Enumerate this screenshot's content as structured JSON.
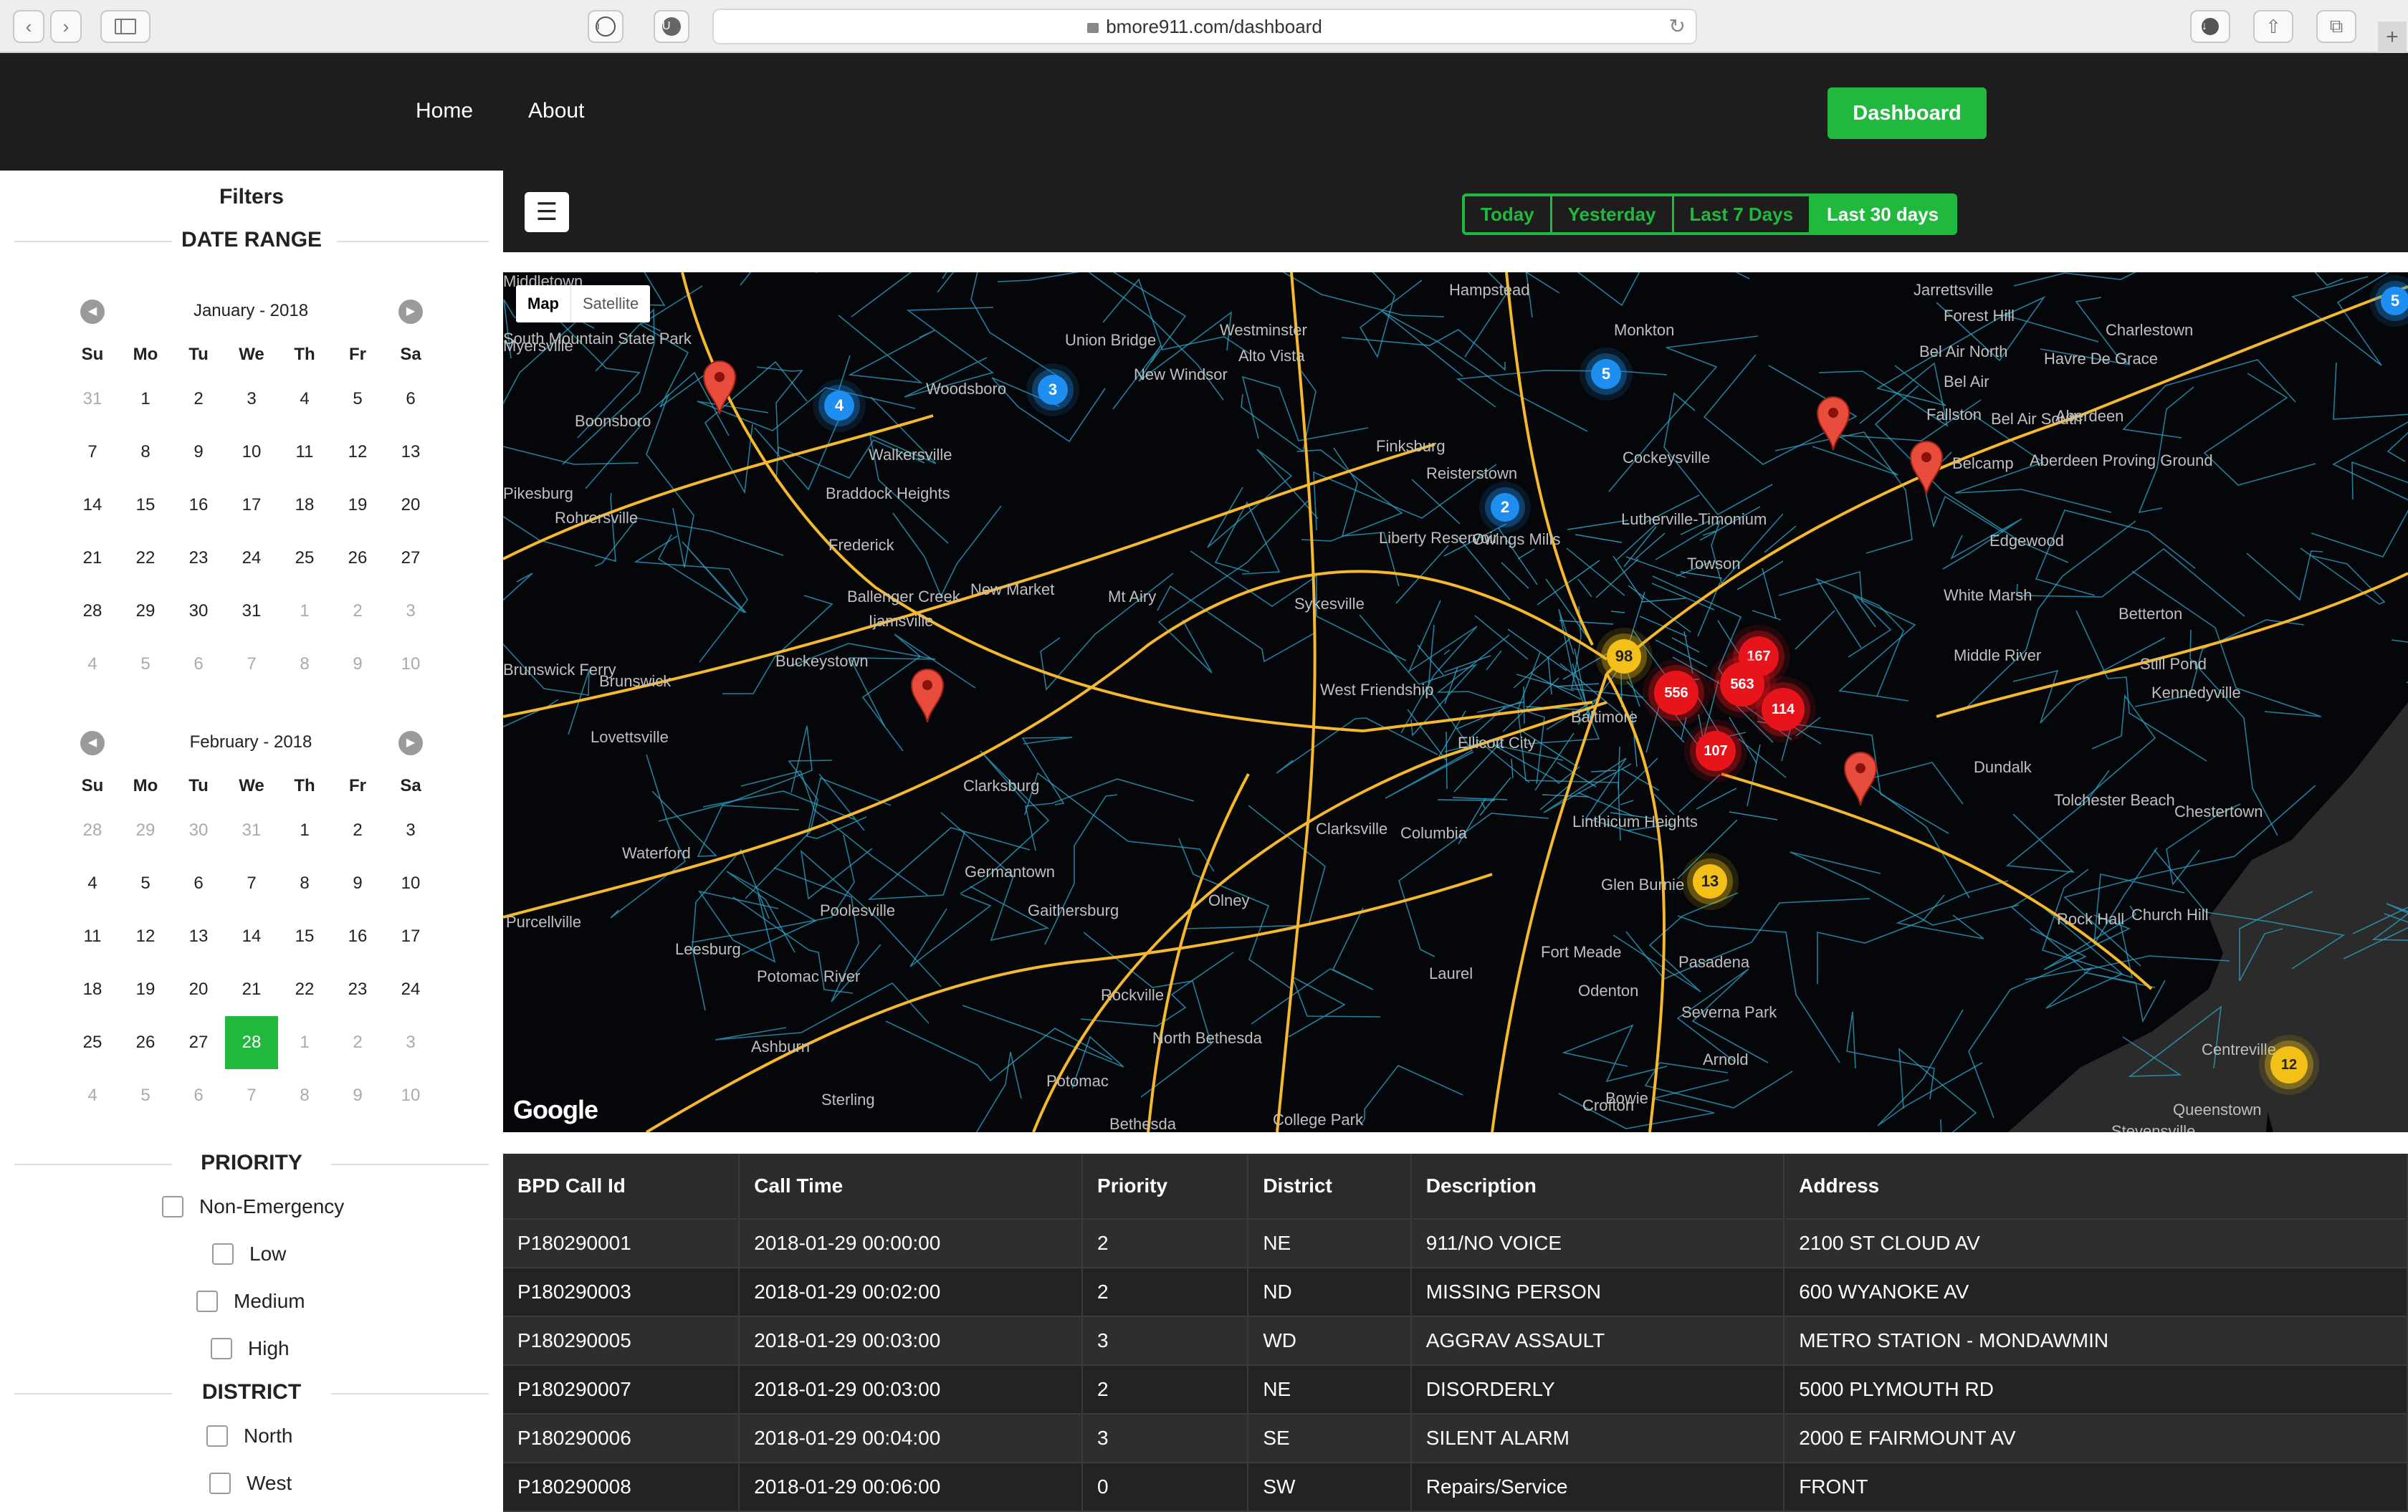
{
  "browser": {
    "url": "bmore911.com/dashboard"
  },
  "nav": {
    "home": "Home",
    "about": "About",
    "dashboard": "Dashboard"
  },
  "filters": {
    "title": "Filters",
    "date_range_title": "DATE RANGE",
    "calendars": [
      {
        "header": "January - 2018",
        "dow": [
          "Su",
          "Mo",
          "Tu",
          "We",
          "Th",
          "Fr",
          "Sa"
        ],
        "weeks": [
          [
            {
              "d": "31",
              "m": 1
            },
            {
              "d": "1"
            },
            {
              "d": "2"
            },
            {
              "d": "3"
            },
            {
              "d": "4"
            },
            {
              "d": "5"
            },
            {
              "d": "6"
            }
          ],
          [
            {
              "d": "7"
            },
            {
              "d": "8"
            },
            {
              "d": "9"
            },
            {
              "d": "10"
            },
            {
              "d": "11"
            },
            {
              "d": "12"
            },
            {
              "d": "13"
            }
          ],
          [
            {
              "d": "14"
            },
            {
              "d": "15"
            },
            {
              "d": "16"
            },
            {
              "d": "17"
            },
            {
              "d": "18"
            },
            {
              "d": "19"
            },
            {
              "d": "20"
            }
          ],
          [
            {
              "d": "21"
            },
            {
              "d": "22"
            },
            {
              "d": "23"
            },
            {
              "d": "24"
            },
            {
              "d": "25"
            },
            {
              "d": "26"
            },
            {
              "d": "27"
            }
          ],
          [
            {
              "d": "28"
            },
            {
              "d": "29"
            },
            {
              "d": "30"
            },
            {
              "d": "31"
            },
            {
              "d": "1",
              "m": 1
            },
            {
              "d": "2",
              "m": 1
            },
            {
              "d": "3",
              "m": 1
            }
          ],
          [
            {
              "d": "4",
              "m": 1
            },
            {
              "d": "5",
              "m": 1
            },
            {
              "d": "6",
              "m": 1
            },
            {
              "d": "7",
              "m": 1
            },
            {
              "d": "8",
              "m": 1
            },
            {
              "d": "9",
              "m": 1
            },
            {
              "d": "10",
              "m": 1
            }
          ]
        ]
      },
      {
        "header": "February - 2018",
        "dow": [
          "Su",
          "Mo",
          "Tu",
          "We",
          "Th",
          "Fr",
          "Sa"
        ],
        "weeks": [
          [
            {
              "d": "28",
              "m": 1
            },
            {
              "d": "29",
              "m": 1
            },
            {
              "d": "30",
              "m": 1
            },
            {
              "d": "31",
              "m": 1
            },
            {
              "d": "1"
            },
            {
              "d": "2"
            },
            {
              "d": "3"
            }
          ],
          [
            {
              "d": "4"
            },
            {
              "d": "5"
            },
            {
              "d": "6"
            },
            {
              "d": "7"
            },
            {
              "d": "8"
            },
            {
              "d": "9"
            },
            {
              "d": "10"
            }
          ],
          [
            {
              "d": "11"
            },
            {
              "d": "12"
            },
            {
              "d": "13"
            },
            {
              "d": "14"
            },
            {
              "d": "15"
            },
            {
              "d": "16"
            },
            {
              "d": "17"
            }
          ],
          [
            {
              "d": "18"
            },
            {
              "d": "19"
            },
            {
              "d": "20"
            },
            {
              "d": "21"
            },
            {
              "d": "22"
            },
            {
              "d": "23"
            },
            {
              "d": "24"
            }
          ],
          [
            {
              "d": "25"
            },
            {
              "d": "26"
            },
            {
              "d": "27"
            },
            {
              "d": "28",
              "s": 1
            },
            {
              "d": "1",
              "m": 1
            },
            {
              "d": "2",
              "m": 1
            },
            {
              "d": "3",
              "m": 1
            }
          ],
          [
            {
              "d": "4",
              "m": 1
            },
            {
              "d": "5",
              "m": 1
            },
            {
              "d": "6",
              "m": 1
            },
            {
              "d": "7",
              "m": 1
            },
            {
              "d": "8",
              "m": 1
            },
            {
              "d": "9",
              "m": 1
            },
            {
              "d": "10",
              "m": 1
            }
          ]
        ]
      }
    ],
    "priority_title": "PRIORITY",
    "priority_options": [
      "Non-Emergency",
      "Low",
      "Medium",
      "High"
    ],
    "district_title": "DISTRICT",
    "district_options": [
      "North",
      "West"
    ]
  },
  "toolbar": {
    "ranges": [
      "Today",
      "Yesterday",
      "Last 7 Days",
      "Last 30 days"
    ],
    "active_range": "Last 30 days"
  },
  "map": {
    "toggle": [
      "Map",
      "Satellite"
    ],
    "active_toggle": "Map",
    "attribution": "Google",
    "places": [
      "Hampstead",
      "Jarrettsville",
      "Forest Hill",
      "Bel Air North",
      "Bel Air",
      "Havre De Grace",
      "Charlestown",
      "Fallston",
      "Bel Air South",
      "Aberdeen",
      "Aberdeen Proving Ground",
      "Belcamp",
      "South Mountain State Park",
      "Myersville",
      "Boonsboro",
      "Woodsboro",
      "Union Bridge",
      "New Windsor",
      "Westminster",
      "Alto Vista",
      "Monkton",
      "Walkersville",
      "Middletown",
      "Braddock Heights",
      "Frederick",
      "Rohrersville",
      "Finksburg",
      "Reisterstown",
      "Cockeysville",
      "Liberty Reservoir",
      "Owings Mills",
      "Lutherville-Timonium",
      "Towson",
      "Edgewood",
      "White Marsh",
      "Middle River",
      "Betterton",
      "Still Pond",
      "Kennedyville",
      "New Market",
      "Mt Airy",
      "Sykesville",
      "Ballenger Creek",
      "Ijamsville",
      "Buckeystown",
      "Brunswick",
      "Lovettsville",
      "West Friendship",
      "Ellicott City",
      "Baltimore",
      "Dundalk",
      "Tolchester Beach",
      "Chestertown",
      "Clarksburg",
      "Clarksville",
      "Columbia",
      "Linthicum Heights",
      "Waterford",
      "Germantown",
      "Olney",
      "Glen Burnie",
      "Rock Hall",
      "Church Hill",
      "Purcellville",
      "Poolesville",
      "Gaithersburg",
      "Fort Meade",
      "Pasadena",
      "Leesburg",
      "Potomac River",
      "Rockville",
      "Laurel",
      "Odenton",
      "Severna Park",
      "North Bethesda",
      "Arnold",
      "Ashburn",
      "Potomac",
      "Bowie",
      "Crofton",
      "Sterling",
      "Bethesda",
      "College Park",
      "Centreville",
      "Queenstown",
      "Stevensville",
      "Brunswick Ferry",
      "Pikesburg"
    ],
    "clusters": [
      {
        "label": "4",
        "level": "blue"
      },
      {
        "label": "3",
        "level": "blue"
      },
      {
        "label": "5",
        "level": "blue"
      },
      {
        "label": "2",
        "level": "blue"
      },
      {
        "label": "5",
        "level": "blue"
      },
      {
        "label": "98",
        "level": "yellow"
      },
      {
        "label": "167",
        "level": "red"
      },
      {
        "label": "556",
        "level": "red"
      },
      {
        "label": "563",
        "level": "red"
      },
      {
        "label": "114",
        "level": "red"
      },
      {
        "label": "107",
        "level": "red"
      },
      {
        "label": "13",
        "level": "yellow"
      },
      {
        "label": "12",
        "level": "yellow"
      }
    ],
    "pin_count": 6,
    "colors": {
      "blue": "#1e8ff0",
      "yellow": "#f2c016",
      "red": "#e8141c",
      "pin": "#e84c3d",
      "road_major": "#f5b82e",
      "road_minor": "#2fa7c9"
    }
  },
  "table": {
    "columns": [
      "BPD Call Id",
      "Call Time",
      "Priority",
      "District",
      "Description",
      "Address"
    ],
    "rows": [
      [
        "P180290001",
        "2018-01-29 00:00:00",
        "2",
        "NE",
        "911/NO VOICE",
        "2100 ST CLOUD AV"
      ],
      [
        "P180290003",
        "2018-01-29 00:02:00",
        "2",
        "ND",
        "MISSING PERSON",
        "600 WYANOKE AV"
      ],
      [
        "P180290005",
        "2018-01-29 00:03:00",
        "3",
        "WD",
        "AGGRAV ASSAULT",
        "METRO STATION - MONDAWMIN"
      ],
      [
        "P180290007",
        "2018-01-29 00:03:00",
        "2",
        "NE",
        "DISORDERLY",
        "5000 PLYMOUTH RD"
      ],
      [
        "P180290006",
        "2018-01-29 00:04:00",
        "3",
        "SE",
        "SILENT ALARM",
        "2000 E FAIRMOUNT AV"
      ],
      [
        "P180290008",
        "2018-01-29 00:06:00",
        "0",
        "SW",
        "Repairs/Service",
        "FRONT"
      ]
    ]
  }
}
